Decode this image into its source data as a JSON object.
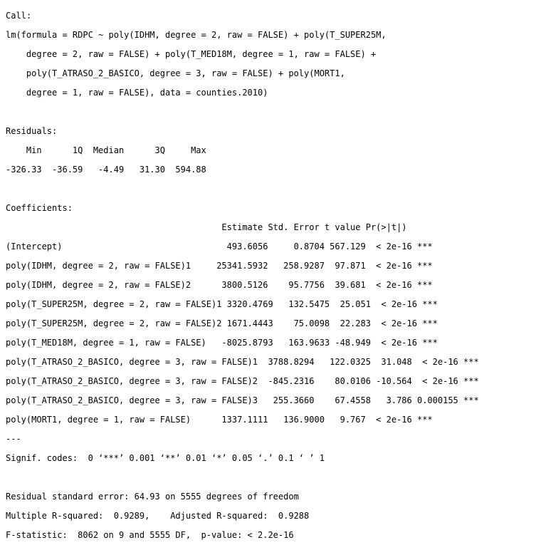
{
  "call": {
    "label": "Call:",
    "lines": [
      "lm(formula = RDPC ~ poly(IDHM, degree = 2, raw = FALSE) + poly(T_SUPER25M,",
      "    degree = 2, raw = FALSE) + poly(T_MED18M, degree = 1, raw = FALSE) +",
      "    poly(T_ATRASO_2_BASICO, degree = 3, raw = FALSE) + poly(MORT1,",
      "    degree = 1, raw = FALSE), data = counties.2010)"
    ]
  },
  "residuals": {
    "label": "Residuals:",
    "header": "    Min      1Q  Median      3Q     Max ",
    "values": "-326.33  -36.59   -4.49   31.30  594.88 "
  },
  "coefficients": {
    "label": "Coefficients:",
    "header": "                                          Estimate Std. Error t value Pr(>|t|)    ",
    "rows": [
      "(Intercept)                                493.6056     0.8704 567.129  < 2e-16 ***",
      "poly(IDHM, degree = 2, raw = FALSE)1     25341.5932   258.9287  97.871  < 2e-16 ***",
      "poly(IDHM, degree = 2, raw = FALSE)2      3800.5126    95.7756  39.681  < 2e-16 ***",
      "poly(T_SUPER25M, degree = 2, raw = FALSE)1 3320.4769   132.5475  25.051  < 2e-16 ***",
      "poly(T_SUPER25M, degree = 2, raw = FALSE)2 1671.4443    75.0098  22.283  < 2e-16 ***",
      "poly(T_MED18M, degree = 1, raw = FALSE)   -8025.8793   163.9633 -48.949  < 2e-16 ***",
      "poly(T_ATRASO_2_BASICO, degree = 3, raw = FALSE)1  3788.8294   122.0325  31.048  < 2e-16 ***",
      "poly(T_ATRASO_2_BASICO, degree = 3, raw = FALSE)2  -845.2316    80.0106 -10.564  < 2e-16 ***",
      "poly(T_ATRASO_2_BASICO, degree = 3, raw = FALSE)3   255.3660    67.4558   3.786 0.000155 ***",
      "poly(MORT1, degree = 1, raw = FALSE)      1337.1111   136.9000   9.767  < 2e-16 ***"
    ],
    "separator": "---",
    "signif_codes": "Signif. codes:  0 ‘***’ 0.001 ‘**’ 0.01 ‘*’ 0.05 ‘.’ 0.1 ‘ ’ 1"
  },
  "summary": {
    "residual_se": "Residual standard error: 64.93 on 5555 degrees of freedom",
    "r_squared": "Multiple R-squared:  0.9289,\tAdjusted R-squared:  0.9288 ",
    "f_statistic": "F-statistic:  8062 on 9 and 5555 DF,  p-value: < 2.2e-16"
  }
}
